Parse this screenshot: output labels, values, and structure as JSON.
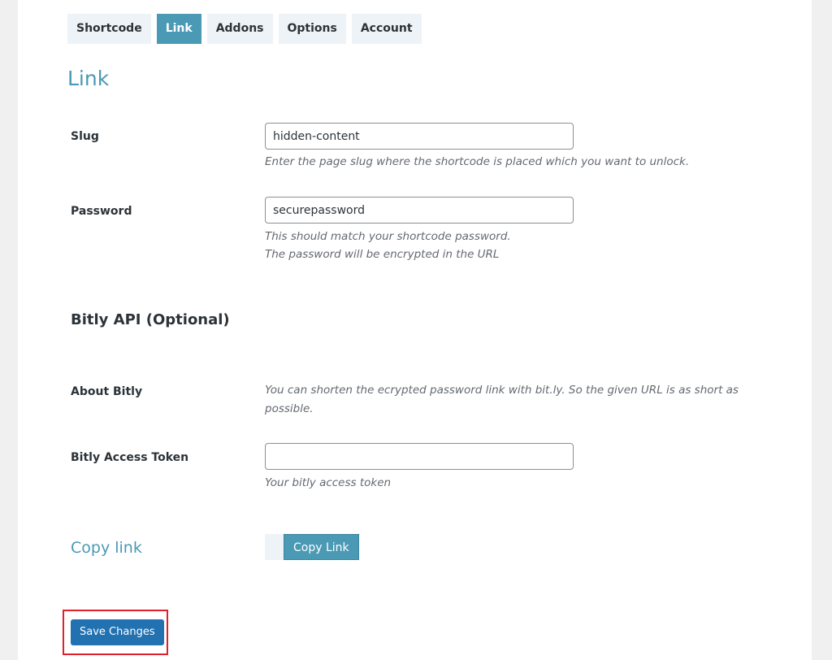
{
  "tabs": [
    {
      "label": "Shortcode",
      "active": false
    },
    {
      "label": "Link",
      "active": true
    },
    {
      "label": "Addons",
      "active": false
    },
    {
      "label": "Options",
      "active": false
    },
    {
      "label": "Account",
      "active": false
    }
  ],
  "page_title": "Link",
  "fields": {
    "slug": {
      "label": "Slug",
      "value": "hidden-content",
      "description": "Enter the page slug where the shortcode is placed which you want to unlock."
    },
    "password": {
      "label": "Password",
      "value": "securepassword",
      "description_line1": "This should match your shortcode password.",
      "description_line2": "The password will be encrypted in the URL"
    }
  },
  "bitly_section": {
    "title": "Bitly API (Optional)",
    "about_label": "About Bitly",
    "about_text_line1": "You can shorten the ecrypted password link with bit.ly. So the given URL is as short as",
    "about_text_line2": "possible.",
    "token_label": "Bitly Access Token",
    "token_value": "",
    "token_description": "Your bitly access token"
  },
  "copy_link": {
    "title": "Copy link",
    "button_label": "Copy Link"
  },
  "save_button_label": "Save Changes",
  "colors": {
    "accent": "#4a99b5",
    "primary_button": "#2271b1",
    "highlight_border": "#e0202a"
  }
}
